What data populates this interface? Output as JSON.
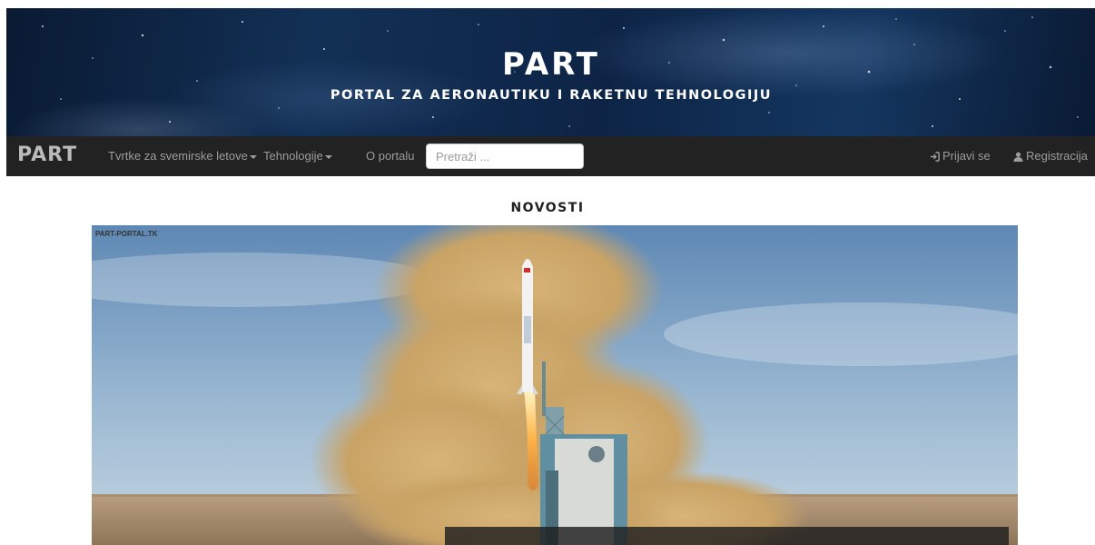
{
  "header": {
    "title": "PART",
    "subtitle": "PORTAL ZA AERONAUTIKU I RAKETNU TEHNOLOGIJU"
  },
  "navbar": {
    "brand": "PART",
    "menu": [
      {
        "label": "Tvrtke za svemirske letove",
        "dropdown": true
      },
      {
        "label": "Tehnologije",
        "dropdown": true
      },
      {
        "label": "O portalu",
        "dropdown": false
      }
    ],
    "search": {
      "placeholder": "Pretraži ...",
      "value": ""
    },
    "login": {
      "label": "Prijavi se",
      "icon": "log-in-icon"
    },
    "register": {
      "label": "Registracija",
      "icon": "user-icon"
    }
  },
  "main": {
    "section_title": "NOVOSTI",
    "hero_watermark": "PART-PORTAL.TK"
  },
  "colors": {
    "navbar_bg": "#222222",
    "nav_text": "#9d9d9d",
    "brand_text": "#bbbbbb",
    "banner_bg": "#0d2446"
  }
}
